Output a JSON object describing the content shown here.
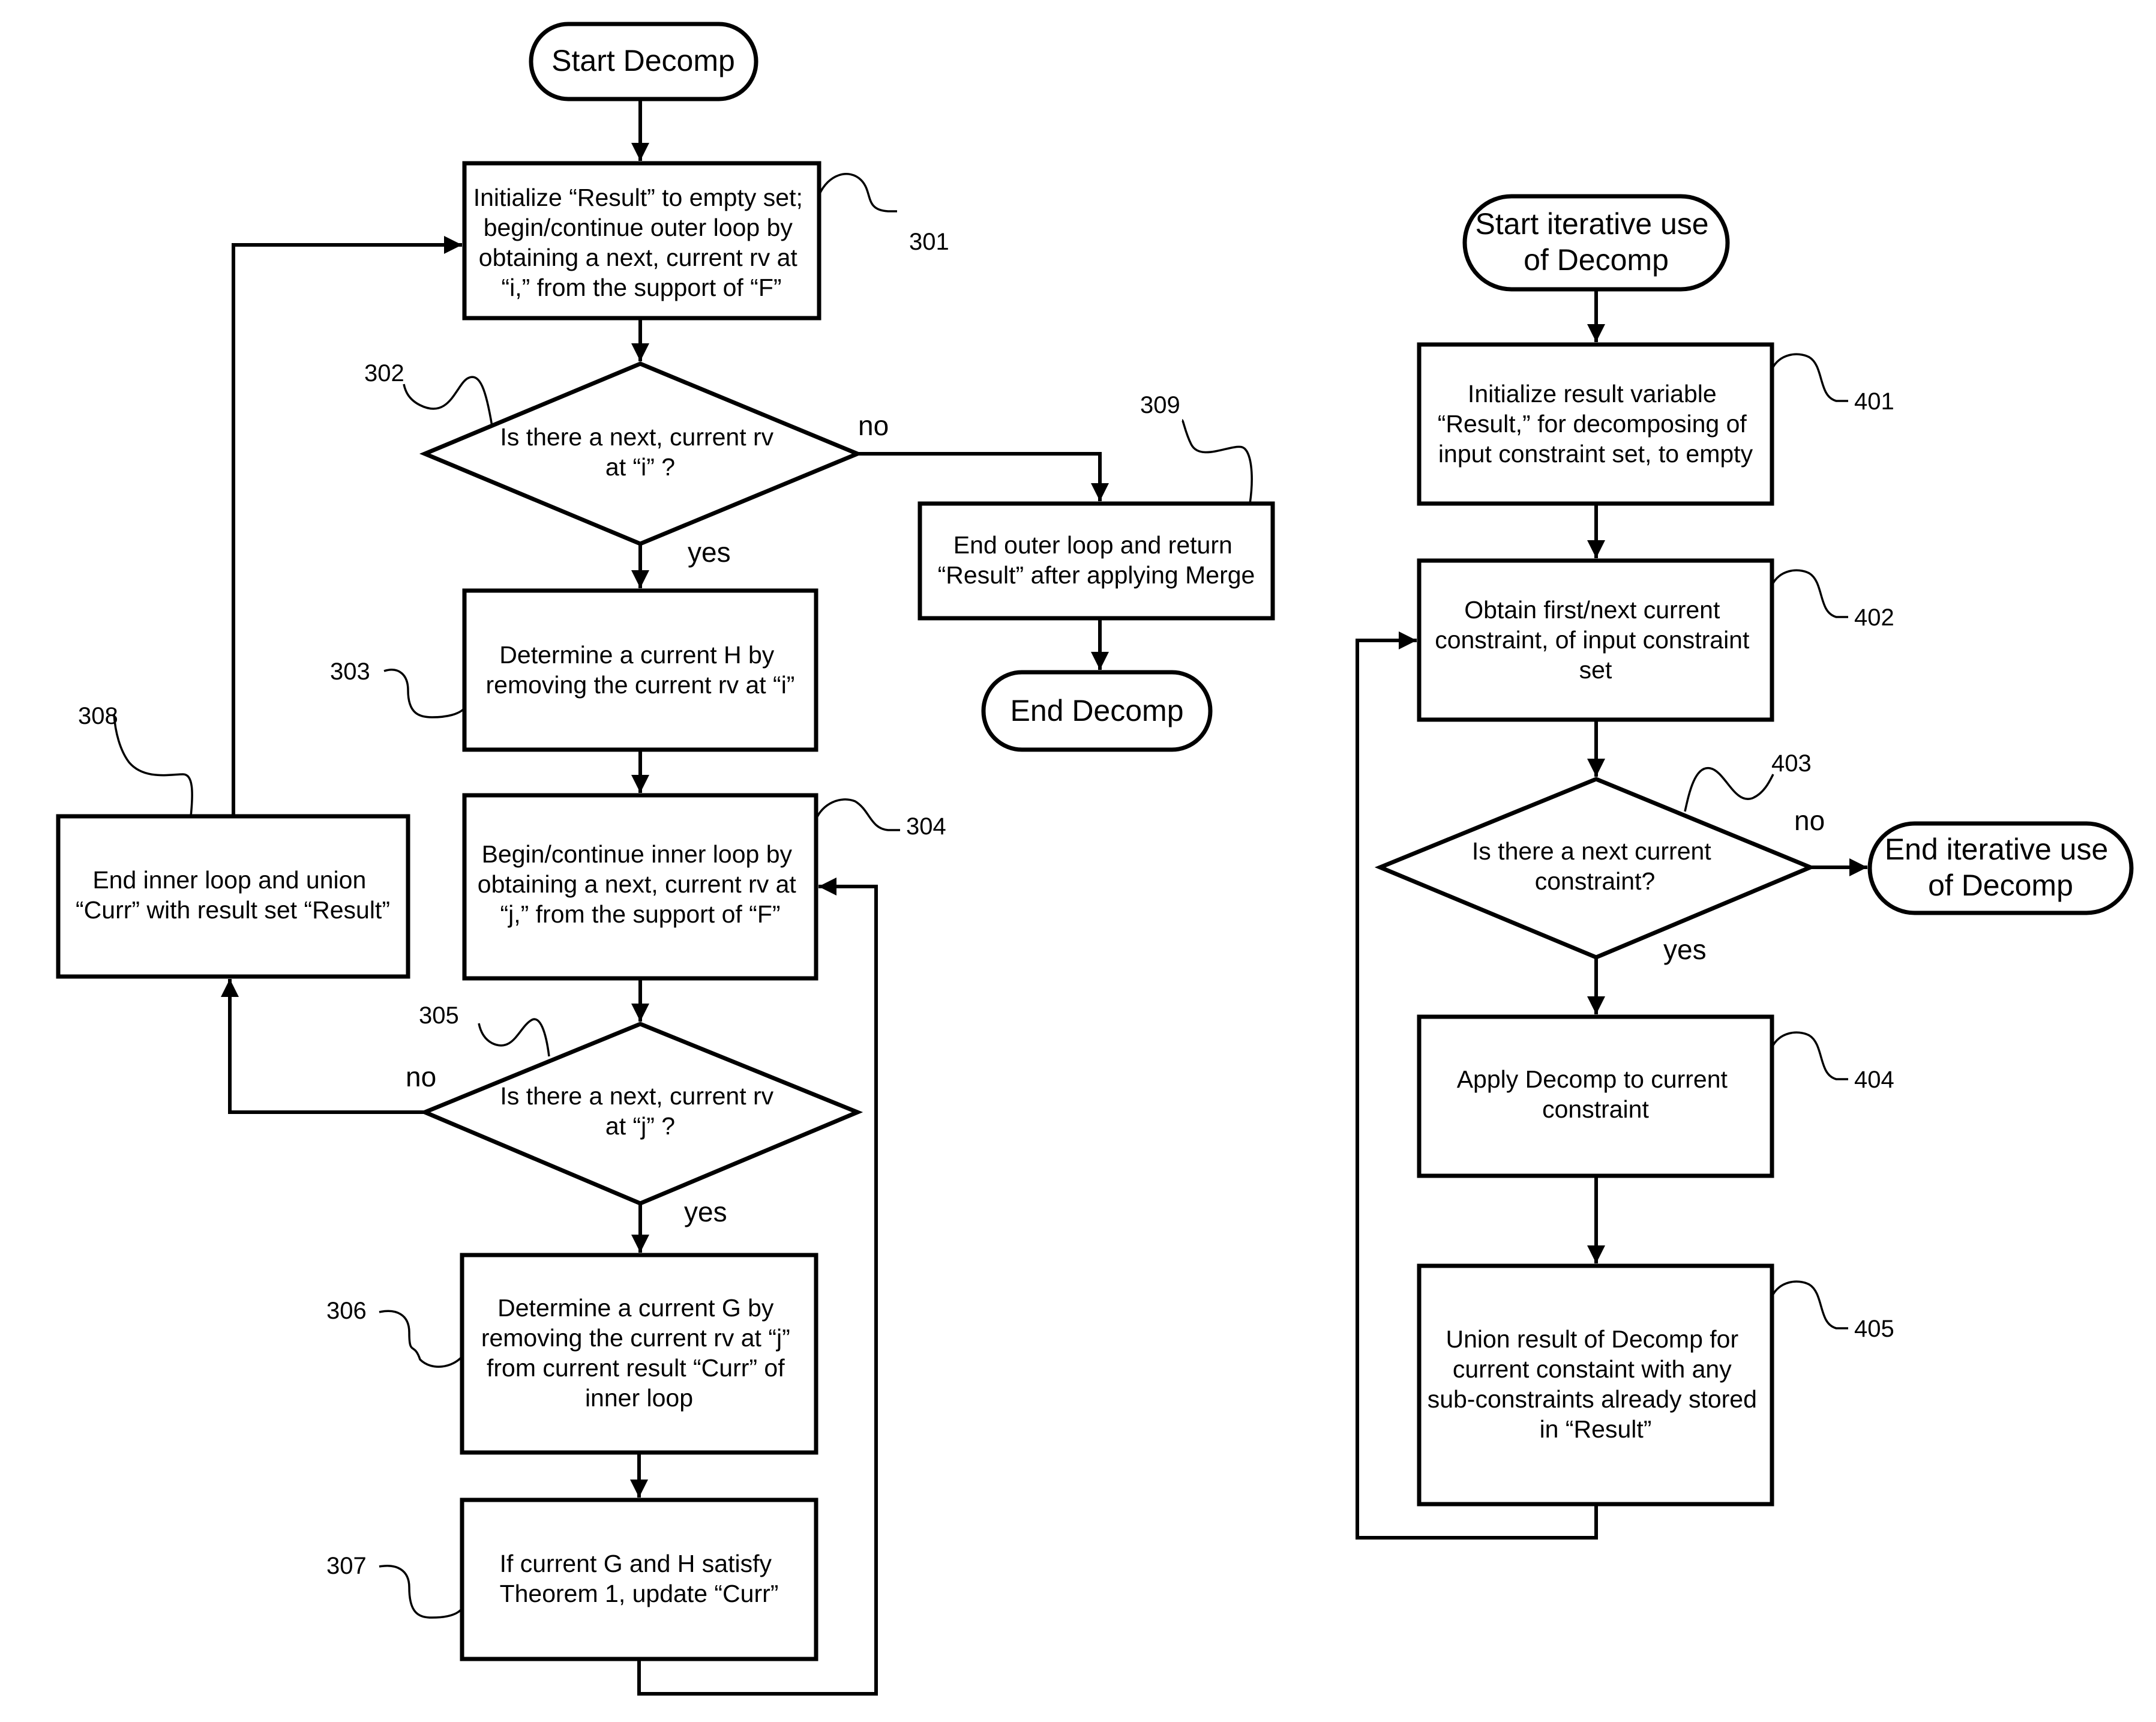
{
  "flowchart_decomp": {
    "start": "Start Decomp",
    "end": "End Decomp",
    "steps": {
      "s301": {
        "ref": "301",
        "lines": [
          "Initialize “Result” to empty set;",
          "begin/continue outer loop by",
          "obtaining a next, current rv at",
          "“i,” from the support of “F”"
        ]
      },
      "s302": {
        "ref": "302",
        "lines": [
          "Is there a next, current rv",
          "at “i” ?"
        ]
      },
      "s303": {
        "ref": "303",
        "lines": [
          "Determine a current H by",
          "removing the current rv at “i”"
        ]
      },
      "s304": {
        "ref": "304",
        "lines": [
          "Begin/continue inner loop by",
          "obtaining a next, current rv at",
          "“j,” from the support of “F”"
        ]
      },
      "s305": {
        "ref": "305",
        "lines": [
          "Is there a next, current rv",
          "at “j” ?"
        ]
      },
      "s306": {
        "ref": "306",
        "lines": [
          "Determine a current G by",
          "removing the current rv at “j”",
          "from current result “Curr” of",
          "inner loop"
        ]
      },
      "s307": {
        "ref": "307",
        "lines": [
          "If current G and H satisfy",
          "Theorem 1, update “Curr”"
        ]
      },
      "s308": {
        "ref": "308",
        "lines": [
          "End inner loop and union",
          "“Curr” with result set “Result”"
        ]
      },
      "s309": {
        "ref": "309",
        "lines": [
          "End outer loop and return",
          "“Result” after applying Merge"
        ]
      }
    },
    "labels": {
      "no_302": "no",
      "yes_302": "yes",
      "no_305": "no",
      "yes_305": "yes"
    }
  },
  "flowchart_iterative": {
    "start_lines": [
      "Start iterative use",
      "of Decomp"
    ],
    "end_lines": [
      "End iterative use",
      "of Decomp"
    ],
    "steps": {
      "s401": {
        "ref": "401",
        "lines": [
          "Initialize result variable",
          "“Result,” for decomposing of",
          "input constraint set, to empty"
        ]
      },
      "s402": {
        "ref": "402",
        "lines": [
          "Obtain first/next current",
          "constraint, of input constraint",
          "set"
        ]
      },
      "s403": {
        "ref": "403",
        "lines": [
          "Is there a next current",
          "constraint?"
        ]
      },
      "s404": {
        "ref": "404",
        "lines": [
          "Apply Decomp to current",
          "constraint"
        ]
      },
      "s405": {
        "ref": "405",
        "lines": [
          "Union result of Decomp for",
          "current constaint with any",
          "sub-constraints already stored",
          "in “Result”"
        ]
      }
    },
    "labels": {
      "no_403": "no",
      "yes_403": "yes"
    }
  }
}
